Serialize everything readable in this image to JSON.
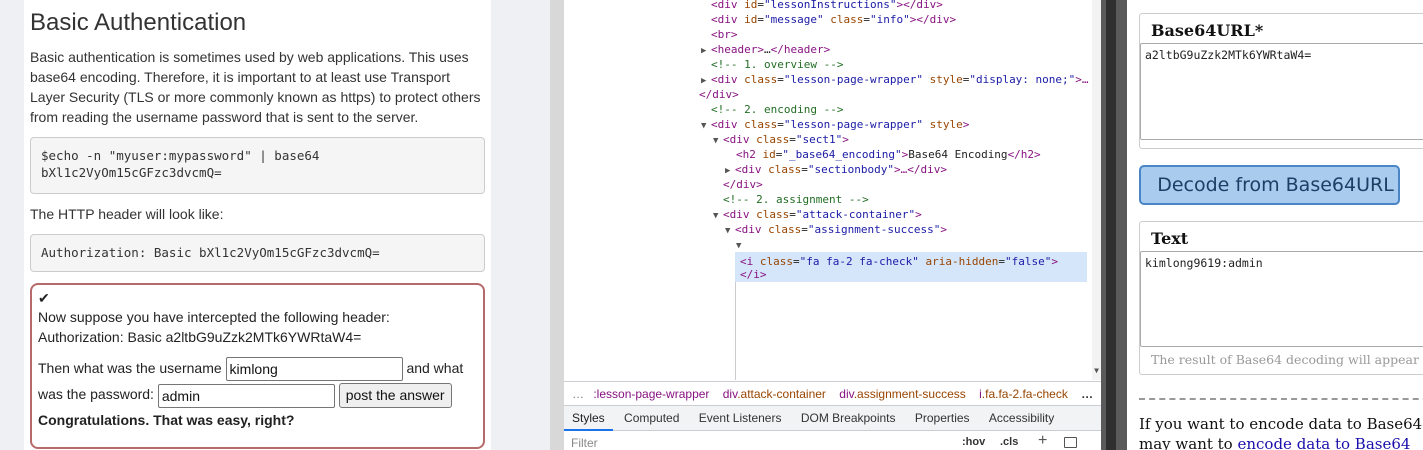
{
  "lesson": {
    "title": "Basic Authentication",
    "intro": "Basic authentication is sometimes used by web applications. This uses base64 encoding. Therefore, it is important to at least use Transport Layer Security (TLS or more commonly known as https) to protect others from reading the username password that is sent to the server.",
    "code_line_1": "$echo -n \"myuser:mypassword\" | base64",
    "code_line_2": "bXl1c2VyOm15cGFzc3dvcmQ=",
    "header_intro": "The HTTP header will look like:",
    "header_example": "Authorization: Basic bXl1c2VyOm15cGFzc3dvcmQ=",
    "check_icon": "✔",
    "question_line_1": "Now suppose you have intercepted the following header:",
    "question_line_2": "Authorization: Basic a2ltbG9uZzk2MTk6YWRtaW4=",
    "username_prompt": "Then what was the username",
    "username_value": "kimlong",
    "and_what": "and what",
    "password_prompt": "was the password:",
    "password_value": "admin",
    "submit_label": "post the answer",
    "feedback": "Congratulations. That was easy, right?"
  },
  "devtools": {
    "dom": {
      "l1": {
        "open": "<div ",
        "attr": "id",
        "val": "\"lessonInstructions\"",
        "close": "></div>"
      },
      "l2": {
        "open": "<div ",
        "attr1": "id",
        "val1": "\"message\"",
        "attr2": "class",
        "val2": "\"info\"",
        "close": "></div>"
      },
      "l3": "<br>",
      "l4": {
        "tag": "<header>",
        "ell": "…",
        "end": "</header>"
      },
      "l5": "<!-- 1. overview -->",
      "l6": {
        "open": "<div ",
        "attr1": "class",
        "val1": "\"lesson-page-wrapper\"",
        "attr2": "style",
        "val2": "\"display: none;\"",
        "close": ">…"
      },
      "l7": "</div>",
      "l8": "<!-- 2. encoding -->",
      "l9": {
        "open": "<div ",
        "attr1": "class",
        "val1": "\"lesson-page-wrapper\"",
        "attr2": "style",
        "close": ">"
      },
      "l10": {
        "open": "<div ",
        "attr": "class",
        "val": "\"sect1\"",
        "close": ">"
      },
      "l11": {
        "open": "<h2 ",
        "attr": "id",
        "val": "\"_base64_encoding\"",
        "mid": ">",
        "text": "Base64 Encoding",
        "close": "</h2>"
      },
      "l12": {
        "open": "<div ",
        "attr": "class",
        "val": "\"sectionbody\"",
        "close": ">…</div>"
      },
      "l13": "</div>",
      "l14": "<!-- 2. assignment -->",
      "l15": {
        "open": "<div ",
        "attr": "class",
        "val": "\"attack-container\"",
        "close": ">"
      },
      "l16": {
        "open": "<div ",
        "attr": "class",
        "val": "\"assignment-success\"",
        "close": ">"
      },
      "l18": {
        "open": "<i ",
        "attr1": "class",
        "val1": "\"fa fa-2 fa-check\"",
        "attr2": "aria-hidden",
        "val2": "\"false\"",
        "close": ">"
      },
      "l19": "</i>"
    },
    "breadcrumbs": {
      "more": "…",
      "c1": ":lesson-page-wrapper",
      "c2_tag": "div",
      "c2_cls": ".attack-container",
      "c3_tag": "div",
      "c3_cls": ".assignment-success",
      "c4_tag": "i",
      "c4_cls": ".fa.fa-2.fa-check",
      "overflow": "…"
    },
    "tabs": [
      "Styles",
      "Computed",
      "Event Listeners",
      "DOM Breakpoints",
      "Properties",
      "Accessibility"
    ],
    "filter_placeholder": "Filter",
    "hov": ":hov",
    "cls": ".cls",
    "plus": "+"
  },
  "b64": {
    "input_label": "Base64URL*",
    "input_value": "a2ltbG9uZzk2MTk6YWRtaW4=",
    "decode_label": "Decode from Base64URL",
    "output_label": "Text",
    "output_value": "kimlong9619:admin",
    "hint": "The result of Base64 decoding will appear",
    "footer_prefix": "If you want to encode data to Base64",
    "footer_line2_prefix": "may want to ",
    "footer_link": "encode data to Base64"
  },
  "colors": {
    "accent_blue": "#1a73e8",
    "assign_border": "#b76a6a",
    "decode_button_bg": "#a9cbee"
  }
}
